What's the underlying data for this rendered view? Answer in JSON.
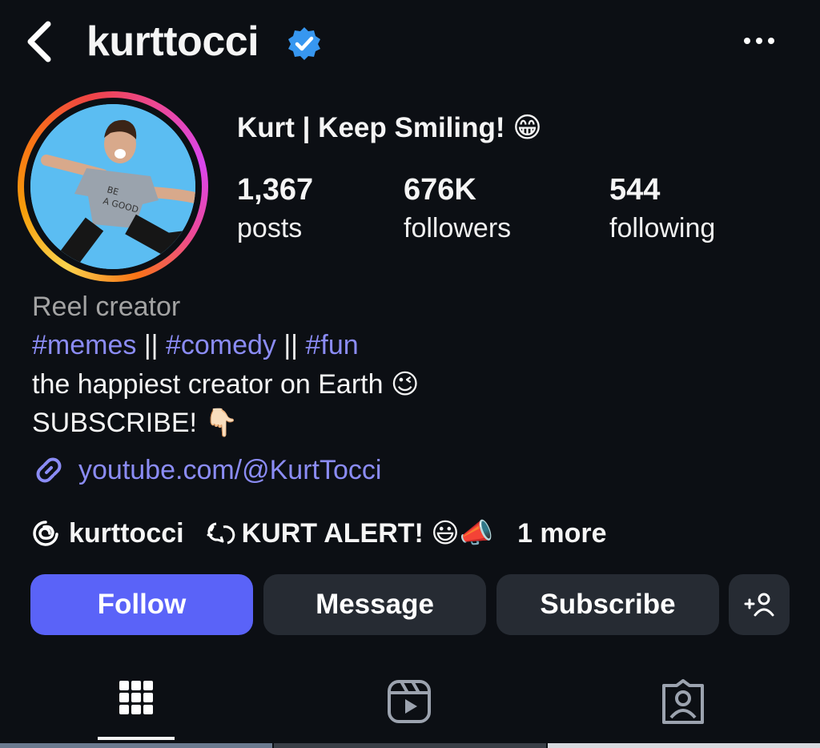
{
  "header": {
    "username": "kurttocci",
    "verified": true
  },
  "profile": {
    "display_name": "Kurt | Keep Smiling! 😁",
    "stats": [
      {
        "value": "1,367",
        "label": "posts"
      },
      {
        "value": "676K",
        "label": "followers"
      },
      {
        "value": "544",
        "label": "following"
      }
    ]
  },
  "bio": {
    "category": "Reel creator",
    "tags": [
      "#memes",
      "#comedy",
      "#fun"
    ],
    "separator": " || ",
    "line1": "the happiest creator on Earth 😉",
    "line2": "SUBSCRIBE! 👇🏻",
    "link": "youtube.com/@KurtTocci"
  },
  "threads": {
    "handle": "kurttocci",
    "channel": "KURT ALERT! 😃📣",
    "more": "1 more"
  },
  "actions": {
    "follow": "Follow",
    "message": "Message",
    "subscribe": "Subscribe"
  },
  "colors": {
    "background": "#0c0f14",
    "accent": "#5a63f8",
    "link": "#8b8cf5",
    "button_secondary": "#262b33",
    "verified": "#3797f0"
  },
  "tabs": [
    "grid-icon",
    "reels-icon",
    "tagged-icon"
  ]
}
